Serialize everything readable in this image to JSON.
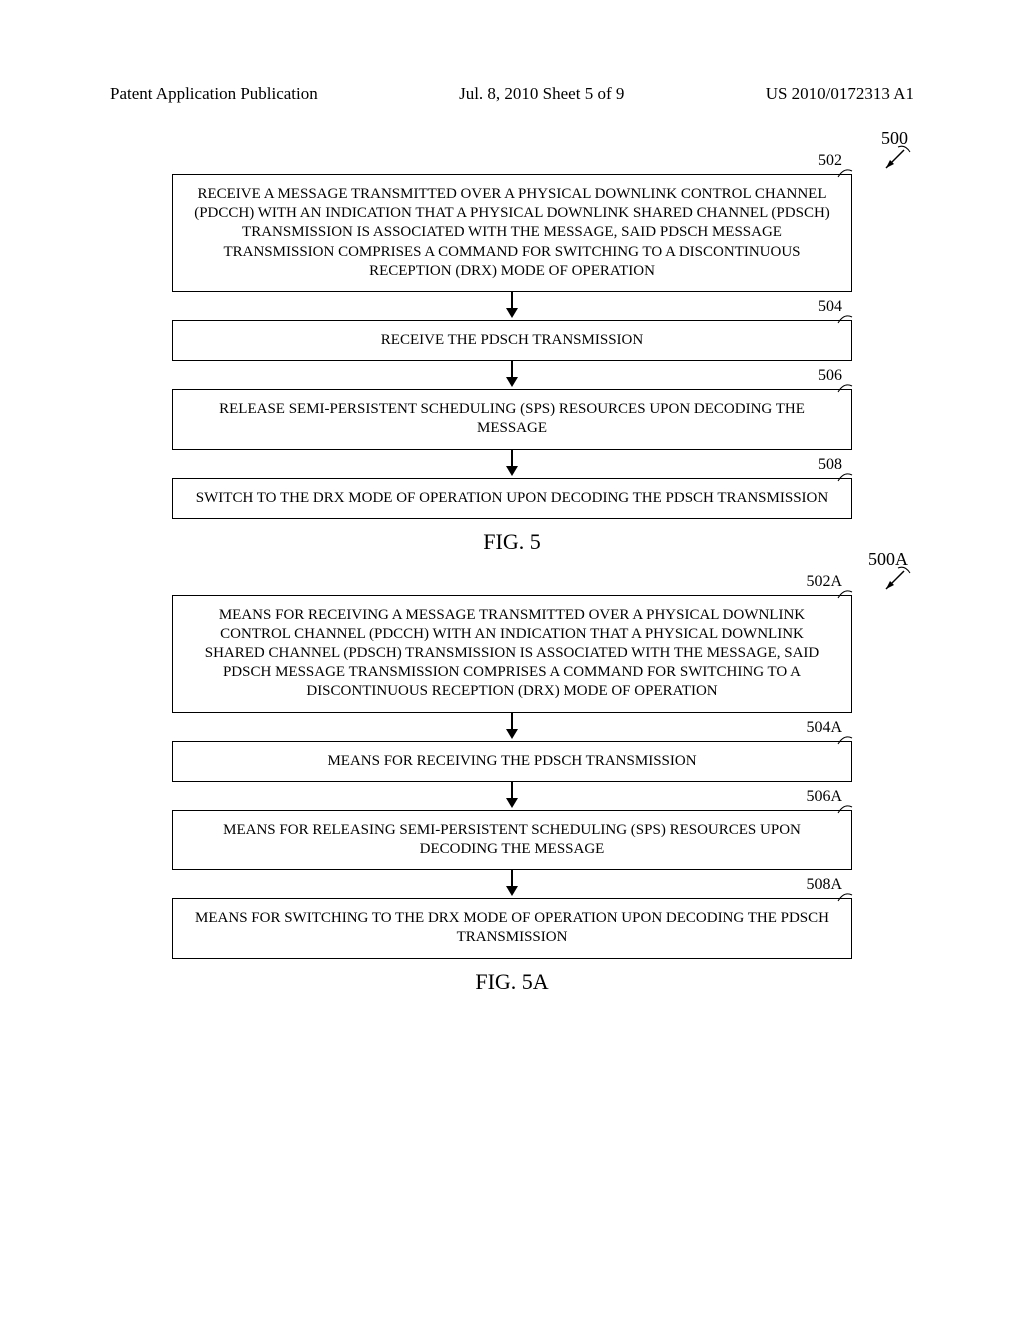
{
  "header": {
    "left": "Patent Application Publication",
    "center": "Jul. 8, 2010  Sheet 5 of 9",
    "right": "US 2010/0172313 A1"
  },
  "fig5": {
    "leader": "500",
    "caption": "FIG. 5",
    "steps": [
      {
        "ref": "502",
        "text": "RECEIVE A MESSAGE TRANSMITTED OVER A PHYSICAL DOWNLINK CONTROL CHANNEL (PDCCH) WITH AN INDICATION THAT A PHYSICAL DOWNLINK SHARED CHANNEL (PDSCH) TRANSMISSION IS ASSOCIATED WITH THE MESSAGE, SAID PDSCH MESSAGE TRANSMISSION COMPRISES A COMMAND FOR SWITCHING TO A DISCONTINUOUS RECEPTION (DRX) MODE OF OPERATION"
      },
      {
        "ref": "504",
        "text": "RECEIVE THE PDSCH TRANSMISSION"
      },
      {
        "ref": "506",
        "text": "RELEASE SEMI-PERSISTENT SCHEDULING (SPS) RESOURCES UPON DECODING THE MESSAGE"
      },
      {
        "ref": "508",
        "text": "SWITCH TO THE DRX MODE OF OPERATION UPON DECODING THE PDSCH TRANSMISSION"
      }
    ]
  },
  "fig5a": {
    "leader": "500A",
    "caption": "FIG. 5A",
    "steps": [
      {
        "ref": "502A",
        "text": "MEANS FOR RECEIVING A MESSAGE TRANSMITTED OVER A PHYSICAL DOWNLINK CONTROL CHANNEL (PDCCH) WITH AN INDICATION THAT A PHYSICAL DOWNLINK SHARED CHANNEL (PDSCH) TRANSMISSION IS ASSOCIATED WITH THE MESSAGE, SAID PDSCH MESSAGE TRANSMISSION COMPRISES A COMMAND FOR SWITCHING TO A DISCONTINUOUS RECEPTION (DRX) MODE OF OPERATION"
      },
      {
        "ref": "504A",
        "text": "MEANS FOR RECEIVING THE PDSCH TRANSMISSION"
      },
      {
        "ref": "506A",
        "text": "MEANS FOR RELEASING SEMI-PERSISTENT SCHEDULING (SPS) RESOURCES UPON DECODING THE MESSAGE"
      },
      {
        "ref": "508A",
        "text": "MEANS FOR SWITCHING TO THE DRX MODE OF OPERATION UPON DECODING THE PDSCH TRANSMISSION"
      }
    ]
  }
}
